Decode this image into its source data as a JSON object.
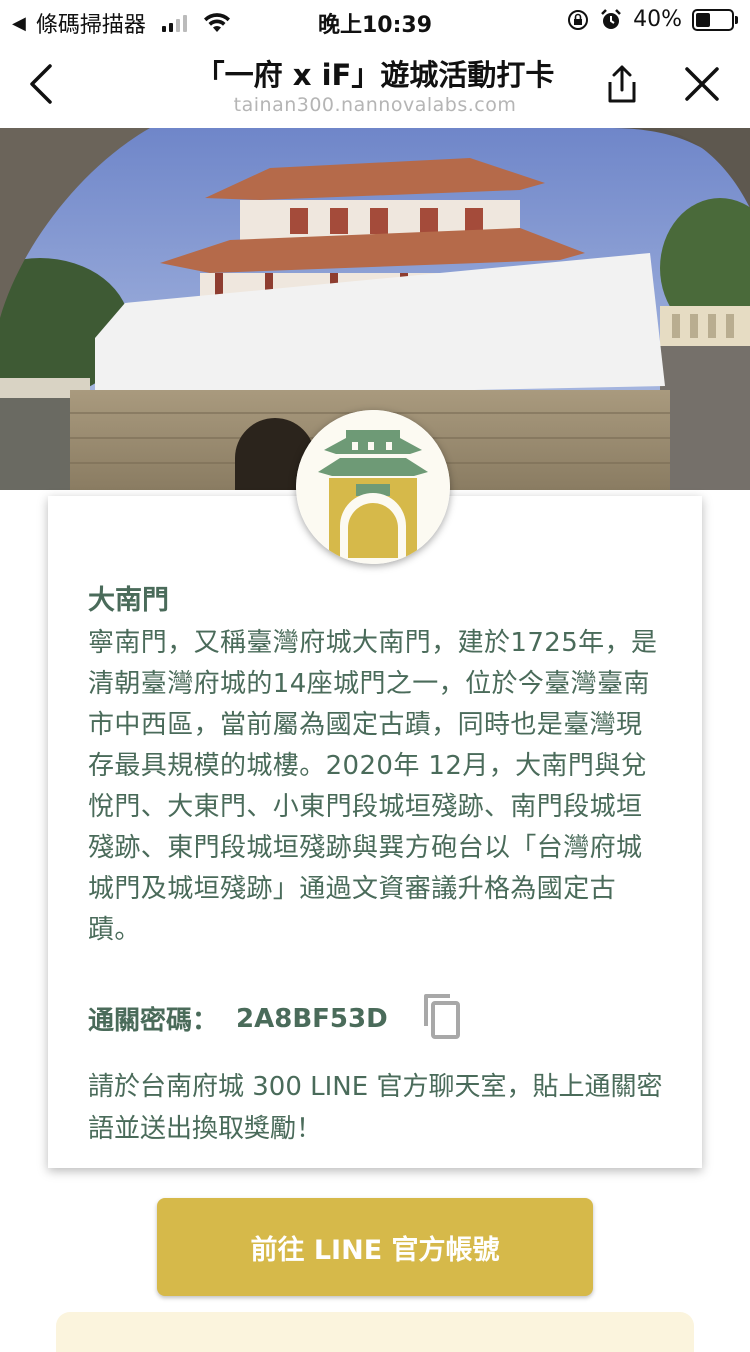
{
  "status_bar": {
    "back_app": "條碼掃描器",
    "time": "晚上10:39",
    "battery": "40%",
    "battery_level": 0.4
  },
  "nav": {
    "title": "「一府 x iF」遊城活動打卡",
    "url": "tainan300.nannovalabs.com",
    "icons": [
      "back-chevron-icon",
      "share-icon",
      "close-icon"
    ]
  },
  "card": {
    "title": "大南門",
    "description": "寧南門，又稱臺灣府城大南門，建於1725年，是清朝臺灣府城的14座城門之一，位於今臺灣臺南市中西區，當前屬為國定古蹟，同時也是臺灣現存最具規模的城樓。2020年 12月，大南門與兌悅門、大東門、小東門段城垣殘跡、南門段城垣殘跡、東門段城垣殘跡與巽方砲台以「台灣府城城門及城垣殘跡」通過文資審議升格為國定古蹟。",
    "code_label": "通關密碼：",
    "code_value": "2A8BF53D",
    "instruction": "請於台南府城 300 LINE 官方聊天室，貼上通關密語並送出換取獎勵！"
  },
  "button": {
    "label": "前往 LINE 官方帳號"
  },
  "colors": {
    "accent_gold": "#d6b94a",
    "text_green": "#4a6b5a",
    "badge_green": "#6e9a76"
  }
}
